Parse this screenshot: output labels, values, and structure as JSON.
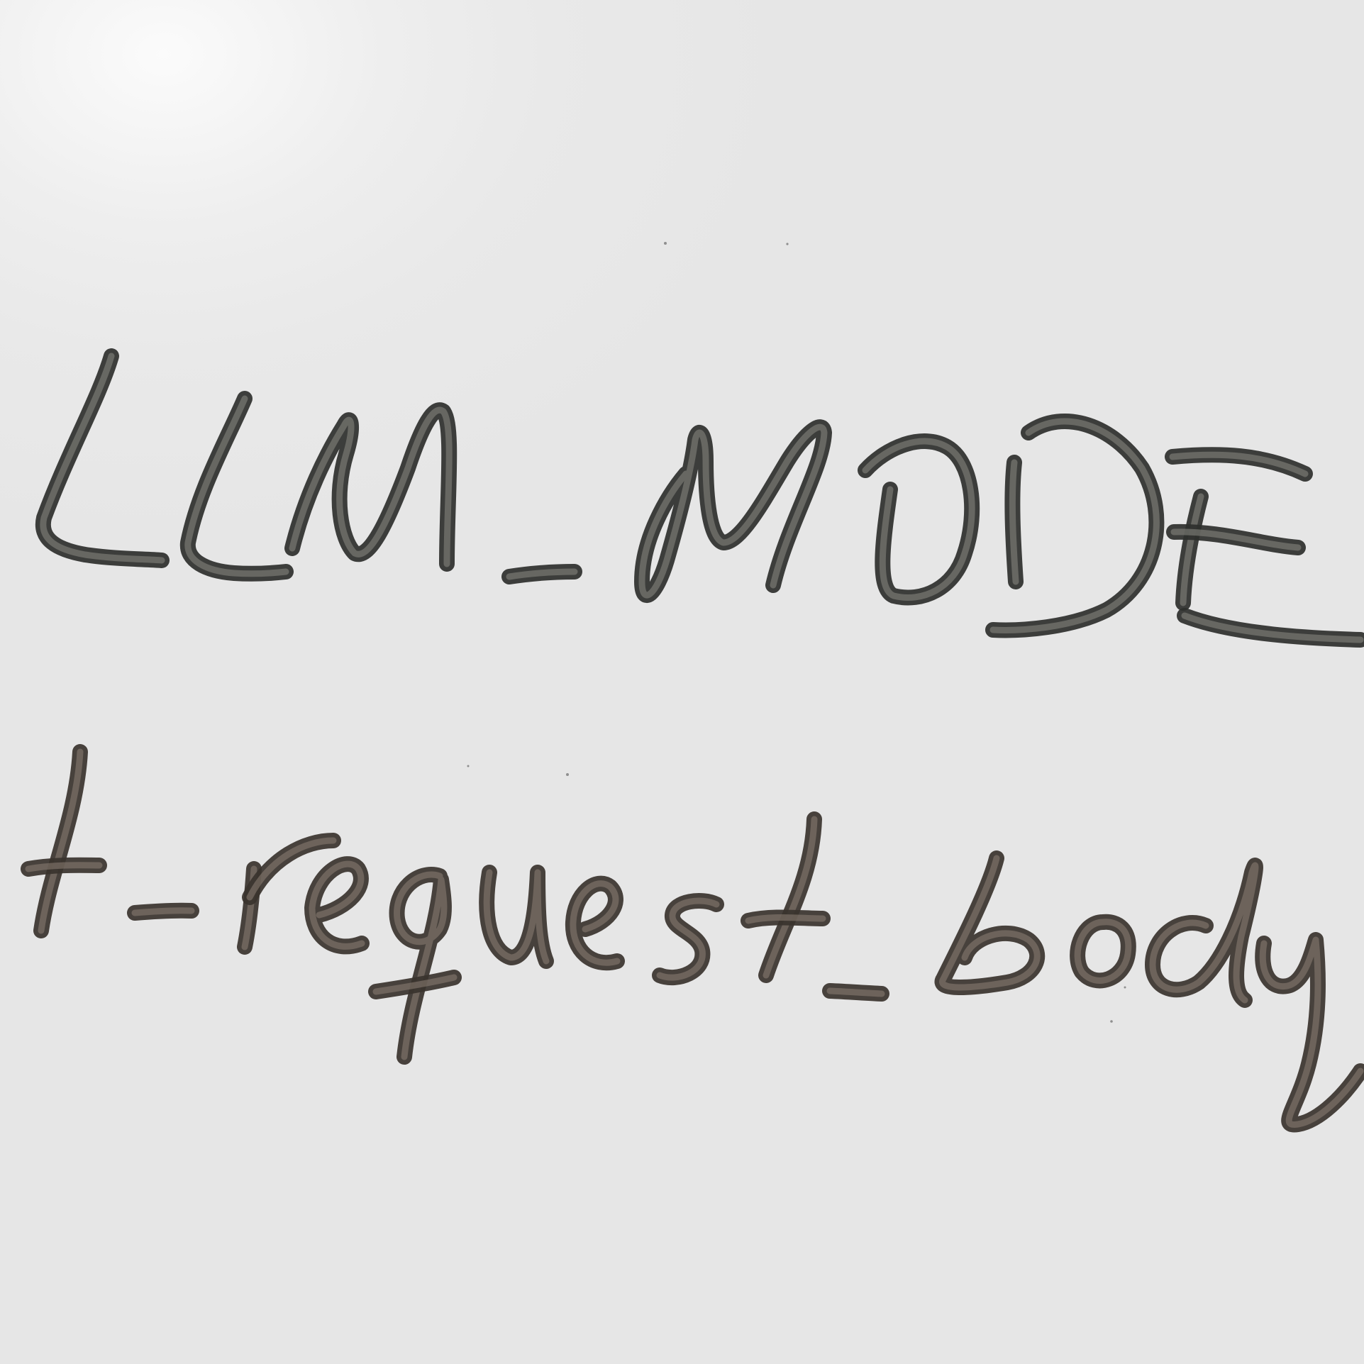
{
  "whiteboard": {
    "line_1": "LLM_MODE",
    "line_2": "t-request_body"
  },
  "colors": {
    "board": "#e9e9e9",
    "ink_dark": "#2e2f2c",
    "ink_brown": "#3a332e"
  }
}
